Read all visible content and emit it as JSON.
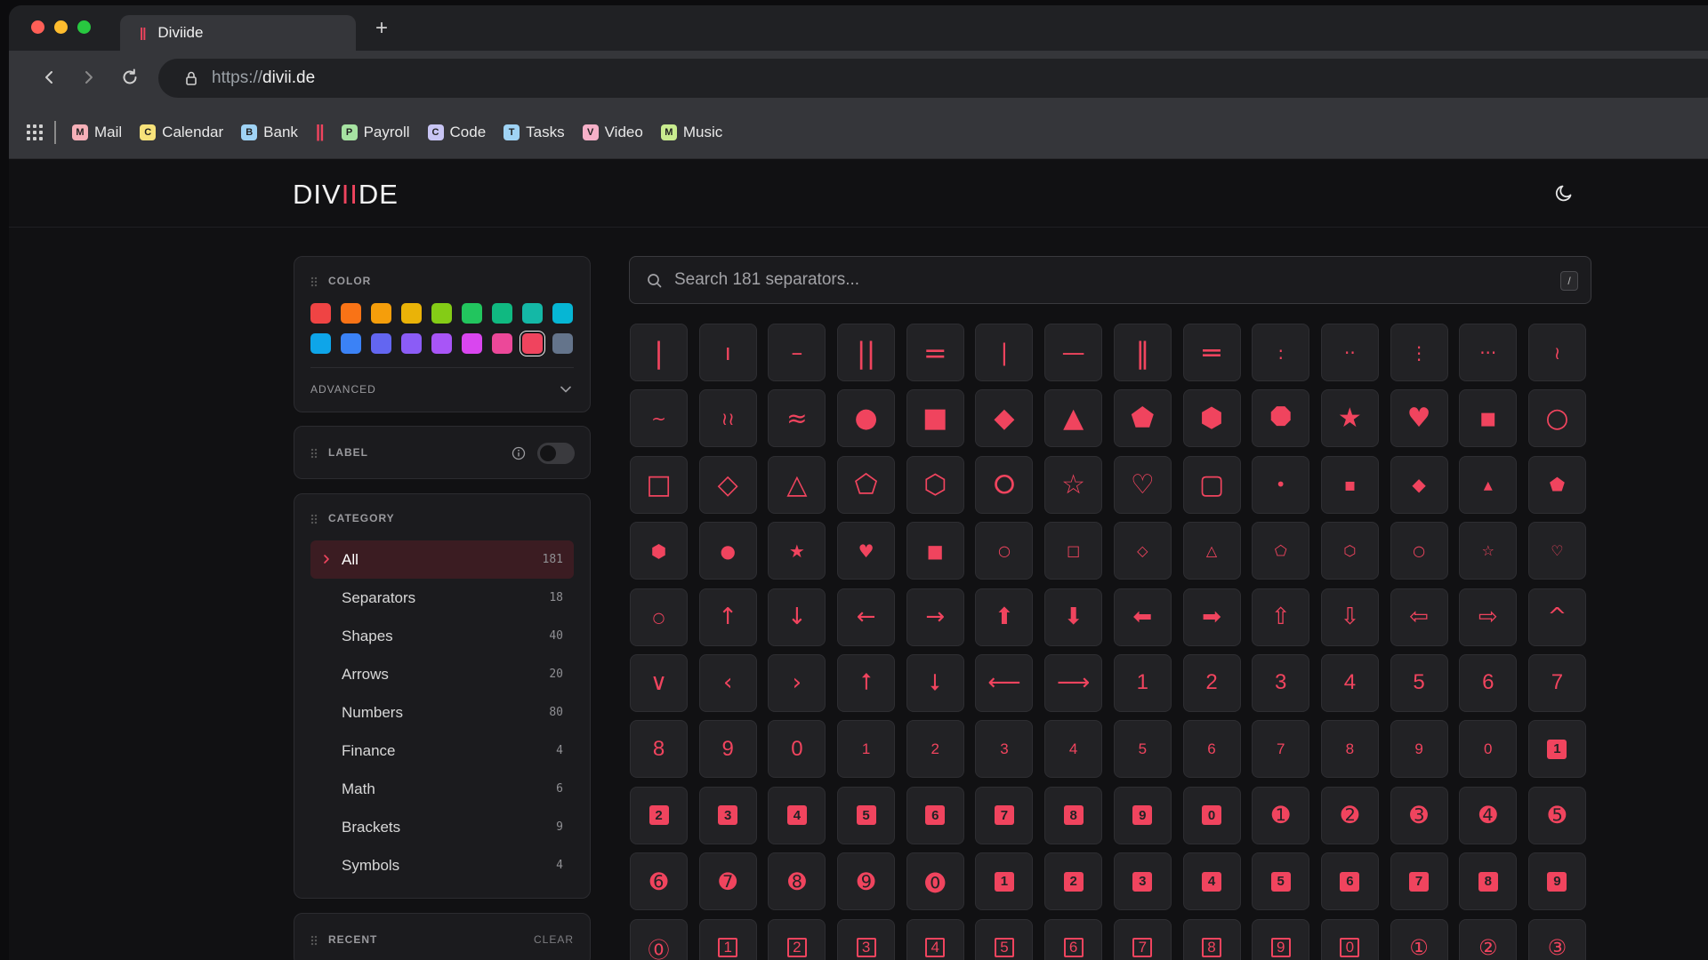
{
  "browser": {
    "tab": {
      "favicon": "||",
      "title": "Diviide",
      "new_tab": "+"
    },
    "url": {
      "scheme": "https://",
      "host": "divii.de"
    },
    "bookmarks": [
      {
        "icon": "M",
        "label": "Mail",
        "color": "#f6b0b8"
      },
      {
        "icon": "C",
        "label": "Calendar",
        "color": "#f7e27a"
      },
      {
        "icon": "B",
        "label": "Bank",
        "color": "#9fd3f5"
      },
      {
        "icon": "||",
        "label": "",
        "color": "#f0445e"
      },
      {
        "icon": "P",
        "label": "Payroll",
        "color": "#a7e3a2"
      },
      {
        "icon": "C",
        "label": "Code",
        "color": "#c8c5f4"
      },
      {
        "icon": "T",
        "label": "Tasks",
        "color": "#9fd3f5"
      },
      {
        "icon": "V",
        "label": "Video",
        "color": "#f6b0c8"
      },
      {
        "icon": "M",
        "label": "Music",
        "color": "#c9ec8f"
      }
    ]
  },
  "app": {
    "logo": {
      "pre": "DIV",
      "accent": "II",
      "post": "DE"
    },
    "accent_color": "#f0445e",
    "theme_icon": "moon-icon"
  },
  "sidebar": {
    "color": {
      "title": "COLOR",
      "swatches": [
        "#ef4444",
        "#f97316",
        "#f59e0b",
        "#eab308",
        "#84cc16",
        "#22c55e",
        "#10b981",
        "#14b8a6",
        "#06b6d4",
        "#0ea5e9",
        "#3b82f6",
        "#6366f1",
        "#8b5cf6",
        "#a855f7",
        "#d946ef",
        "#ec4899",
        "#f0445e",
        "#64748b"
      ],
      "selected_index": 16,
      "advanced_label": "ADVANCED"
    },
    "label": {
      "title": "LABEL",
      "toggle_on": false
    },
    "category": {
      "title": "CATEGORY",
      "items": [
        {
          "label": "All",
          "count": "181",
          "active": true
        },
        {
          "label": "Separators",
          "count": "18"
        },
        {
          "label": "Shapes",
          "count": "40"
        },
        {
          "label": "Arrows",
          "count": "20"
        },
        {
          "label": "Numbers",
          "count": "80"
        },
        {
          "label": "Finance",
          "count": "4"
        },
        {
          "label": "Math",
          "count": "6"
        },
        {
          "label": "Brackets",
          "count": "9"
        },
        {
          "label": "Symbols",
          "count": "4"
        }
      ]
    },
    "recent": {
      "title": "RECENT",
      "clear_label": "CLEAR"
    }
  },
  "search": {
    "placeholder": "Search 181 separators...",
    "shortcut": "/"
  },
  "grid": {
    "items": [
      "|",
      "ı",
      "–",
      "||",
      "=",
      "|",
      "—",
      "‖",
      "═",
      ":",
      "··",
      "⋮",
      "···",
      "≀",
      "~",
      "≀≀",
      "≈",
      "●",
      "■",
      "◆",
      "▲",
      "⬟",
      "⬢",
      "⯃",
      "★",
      "♥",
      "▪",
      "○",
      "□",
      "◇",
      "△",
      "⬠",
      "⬡",
      "⭘",
      "☆",
      "♡",
      "▢",
      "•",
      "▪",
      "◆",
      "▴",
      "⬟",
      "⬢",
      "●",
      "★",
      "♥",
      "■",
      "○",
      "□",
      "◇",
      "△",
      "⬠",
      "⬡",
      "○",
      "☆",
      "♡",
      "○",
      "↑",
      "↓",
      "←",
      "→",
      "⬆",
      "⬇",
      "⬅",
      "➡",
      "⇧",
      "⇩",
      "⇦",
      "⇨",
      "^",
      "∨",
      "‹",
      "›",
      "⭡",
      "⭣",
      "⟵",
      "⟶",
      "1",
      "2",
      "3",
      "4",
      "5",
      "6",
      "7",
      "8",
      "9",
      "0",
      "1",
      "2",
      "3",
      "4",
      "5",
      "6",
      "7",
      "8",
      "9",
      "0",
      "1",
      "2",
      "3",
      "4",
      "5",
      "6",
      "7",
      "8",
      "9",
      "0",
      "➊",
      "➋",
      "➌",
      "➍",
      "➎",
      "➏",
      "➐",
      "➑",
      "➒",
      "⓿",
      "1",
      "2",
      "3",
      "4",
      "5",
      "6",
      "7",
      "8",
      "9",
      "⓪",
      "1",
      "2",
      "3",
      "4",
      "5",
      "6",
      "7",
      "8",
      "9",
      "0",
      "①",
      "②",
      "③"
    ],
    "styles": [
      "bar",
      "thin",
      "dash",
      "bar",
      "bar",
      "thin",
      "dash",
      "bar",
      "bar",
      "sm",
      "sm",
      "sm",
      "sm",
      "sm",
      "sm",
      "sm",
      "md",
      "shape",
      "shape",
      "shape",
      "shape",
      "shape",
      "shape",
      "shape",
      "shape",
      "shape",
      "shape",
      "shape",
      "shape",
      "shape",
      "shape",
      "shape",
      "shape",
      "shape",
      "shape",
      "shape",
      "shape",
      "sm",
      "sm",
      "sm",
      "sm",
      "sm",
      "sm",
      "sm",
      "sm",
      "sm",
      "sm",
      "xs",
      "xs",
      "xs",
      "xs",
      "xs",
      "xs",
      "xs",
      "xs",
      "xs",
      "xs",
      "arrow",
      "arrow",
      "arrow",
      "arrow",
      "arrow",
      "arrow",
      "arrow",
      "arrow",
      "arrow",
      "arrow",
      "arrow",
      "arrow",
      "arrow",
      "arrow",
      "arrow",
      "arrow",
      "arrow",
      "arrow",
      "arrow",
      "arrow",
      "num",
      "num",
      "num",
      "num",
      "num",
      "num",
      "num",
      "num",
      "num",
      "num",
      "numsm",
      "numsm",
      "numsm",
      "numsm",
      "numsm",
      "numsm",
      "numsm",
      "numsm",
      "numsm",
      "numsm",
      "boxfill",
      "boxfill",
      "boxfill",
      "boxfill",
      "boxfill",
      "boxfill",
      "boxfill",
      "boxfill",
      "boxfill",
      "boxfill",
      "circfill",
      "circfill",
      "circfill",
      "circfill",
      "circfill",
      "circfill",
      "circfill",
      "circfill",
      "circfill",
      "circfill",
      "boxfill",
      "boxfill",
      "boxfill",
      "boxfill",
      "boxfill",
      "boxfill",
      "boxfill",
      "boxfill",
      "boxfill",
      "circfill",
      "box",
      "box",
      "box",
      "box",
      "box",
      "box",
      "box",
      "box",
      "box",
      "box",
      "circ",
      "circ",
      "circ"
    ]
  }
}
